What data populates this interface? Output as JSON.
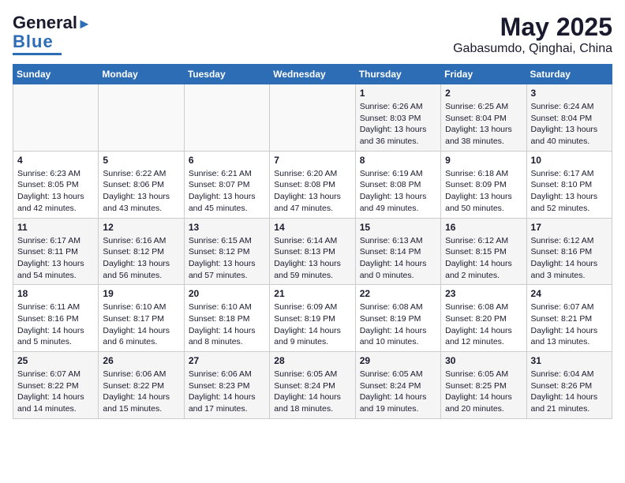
{
  "header": {
    "logo_general": "General",
    "logo_blue": "Blue",
    "month_year": "May 2025",
    "location": "Gabasumdo, Qinghai, China"
  },
  "days_of_week": [
    "Sunday",
    "Monday",
    "Tuesday",
    "Wednesday",
    "Thursday",
    "Friday",
    "Saturday"
  ],
  "weeks": [
    [
      {
        "num": "",
        "info": ""
      },
      {
        "num": "",
        "info": ""
      },
      {
        "num": "",
        "info": ""
      },
      {
        "num": "",
        "info": ""
      },
      {
        "num": "1",
        "info": "Sunrise: 6:26 AM\nSunset: 8:03 PM\nDaylight: 13 hours and 36 minutes."
      },
      {
        "num": "2",
        "info": "Sunrise: 6:25 AM\nSunset: 8:04 PM\nDaylight: 13 hours and 38 minutes."
      },
      {
        "num": "3",
        "info": "Sunrise: 6:24 AM\nSunset: 8:04 PM\nDaylight: 13 hours and 40 minutes."
      }
    ],
    [
      {
        "num": "4",
        "info": "Sunrise: 6:23 AM\nSunset: 8:05 PM\nDaylight: 13 hours and 42 minutes."
      },
      {
        "num": "5",
        "info": "Sunrise: 6:22 AM\nSunset: 8:06 PM\nDaylight: 13 hours and 43 minutes."
      },
      {
        "num": "6",
        "info": "Sunrise: 6:21 AM\nSunset: 8:07 PM\nDaylight: 13 hours and 45 minutes."
      },
      {
        "num": "7",
        "info": "Sunrise: 6:20 AM\nSunset: 8:08 PM\nDaylight: 13 hours and 47 minutes."
      },
      {
        "num": "8",
        "info": "Sunrise: 6:19 AM\nSunset: 8:08 PM\nDaylight: 13 hours and 49 minutes."
      },
      {
        "num": "9",
        "info": "Sunrise: 6:18 AM\nSunset: 8:09 PM\nDaylight: 13 hours and 50 minutes."
      },
      {
        "num": "10",
        "info": "Sunrise: 6:17 AM\nSunset: 8:10 PM\nDaylight: 13 hours and 52 minutes."
      }
    ],
    [
      {
        "num": "11",
        "info": "Sunrise: 6:17 AM\nSunset: 8:11 PM\nDaylight: 13 hours and 54 minutes."
      },
      {
        "num": "12",
        "info": "Sunrise: 6:16 AM\nSunset: 8:12 PM\nDaylight: 13 hours and 56 minutes."
      },
      {
        "num": "13",
        "info": "Sunrise: 6:15 AM\nSunset: 8:12 PM\nDaylight: 13 hours and 57 minutes."
      },
      {
        "num": "14",
        "info": "Sunrise: 6:14 AM\nSunset: 8:13 PM\nDaylight: 13 hours and 59 minutes."
      },
      {
        "num": "15",
        "info": "Sunrise: 6:13 AM\nSunset: 8:14 PM\nDaylight: 14 hours and 0 minutes."
      },
      {
        "num": "16",
        "info": "Sunrise: 6:12 AM\nSunset: 8:15 PM\nDaylight: 14 hours and 2 minutes."
      },
      {
        "num": "17",
        "info": "Sunrise: 6:12 AM\nSunset: 8:16 PM\nDaylight: 14 hours and 3 minutes."
      }
    ],
    [
      {
        "num": "18",
        "info": "Sunrise: 6:11 AM\nSunset: 8:16 PM\nDaylight: 14 hours and 5 minutes."
      },
      {
        "num": "19",
        "info": "Sunrise: 6:10 AM\nSunset: 8:17 PM\nDaylight: 14 hours and 6 minutes."
      },
      {
        "num": "20",
        "info": "Sunrise: 6:10 AM\nSunset: 8:18 PM\nDaylight: 14 hours and 8 minutes."
      },
      {
        "num": "21",
        "info": "Sunrise: 6:09 AM\nSunset: 8:19 PM\nDaylight: 14 hours and 9 minutes."
      },
      {
        "num": "22",
        "info": "Sunrise: 6:08 AM\nSunset: 8:19 PM\nDaylight: 14 hours and 10 minutes."
      },
      {
        "num": "23",
        "info": "Sunrise: 6:08 AM\nSunset: 8:20 PM\nDaylight: 14 hours and 12 minutes."
      },
      {
        "num": "24",
        "info": "Sunrise: 6:07 AM\nSunset: 8:21 PM\nDaylight: 14 hours and 13 minutes."
      }
    ],
    [
      {
        "num": "25",
        "info": "Sunrise: 6:07 AM\nSunset: 8:22 PM\nDaylight: 14 hours and 14 minutes."
      },
      {
        "num": "26",
        "info": "Sunrise: 6:06 AM\nSunset: 8:22 PM\nDaylight: 14 hours and 15 minutes."
      },
      {
        "num": "27",
        "info": "Sunrise: 6:06 AM\nSunset: 8:23 PM\nDaylight: 14 hours and 17 minutes."
      },
      {
        "num": "28",
        "info": "Sunrise: 6:05 AM\nSunset: 8:24 PM\nDaylight: 14 hours and 18 minutes."
      },
      {
        "num": "29",
        "info": "Sunrise: 6:05 AM\nSunset: 8:24 PM\nDaylight: 14 hours and 19 minutes."
      },
      {
        "num": "30",
        "info": "Sunrise: 6:05 AM\nSunset: 8:25 PM\nDaylight: 14 hours and 20 minutes."
      },
      {
        "num": "31",
        "info": "Sunrise: 6:04 AM\nSunset: 8:26 PM\nDaylight: 14 hours and 21 minutes."
      }
    ]
  ]
}
